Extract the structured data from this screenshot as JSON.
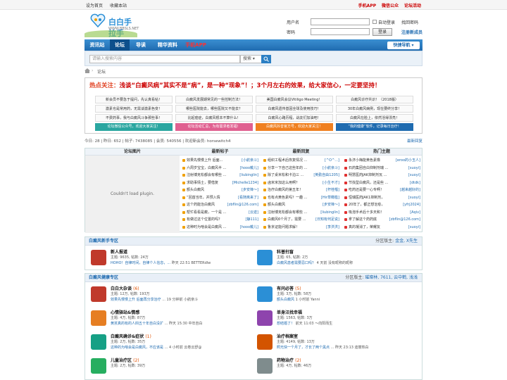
{
  "topbar": {
    "left": [
      "设为首页",
      "收藏本站"
    ],
    "right": [
      "手机APP",
      "微信公众",
      "论坛活动"
    ]
  },
  "logo": {
    "name": "白白手拉手",
    "url": "WWW.BBSLS.NET"
  },
  "login": {
    "username_label": "用户名",
    "password_label": "密码",
    "auto_login": "自动登录",
    "forgot": "找回密码",
    "login_button": "登录",
    "register": "注册新成员"
  },
  "nav": {
    "items": [
      "资讯站",
      "论坛",
      "导读",
      "精华资料",
      "手机APP"
    ],
    "quick": "快捷导航"
  },
  "search": {
    "placeholder": "请输入搜索内容",
    "select": "搜索",
    "button": "🔍"
  },
  "breadcrumb": {
    "home_icon": "home-icon",
    "current": "论坛"
  },
  "hot": {
    "lead": "热点关注：",
    "title": "浅谈“白癜风病”其实不是“病”，是一种“现象”！；3个月左右的效果，给大家信心，一定要坚持！",
    "cells": [
      [
        "新会员不要急于提问，先认真看帖！",
        "白癜风发展期常见的一些控制方法！",
        "美国白癜风会议Vitiligo Meeting！",
        "白癜风诊疗共识！（2018版）"
      ],
      [
        "激素也是常用药，无需谈激素色变！",
        "哪些医院能去，哪些医院又不能去？",
        "白癜风遗传基因全球及使用技巧！",
        "30年白癜风病例，现在要终分享！"
      ],
      [
        "不费药事，我与白癜风斗争那些事！",
        "比起癌症，白癜风根本不算什么！",
        "白癜风心路历程，战友们加油吧！",
        "白癜风在脸上，依然活得漂亮！"
      ],
      [
        "论坛微信公众号，欢迎大家关注！",
        "论坛活动汇总，为有需求者发福！",
        "白癜风抖音官方号，欢迎大家关注！",
        "“我的健康”软件，记录每日治疗！"
      ]
    ],
    "cell_colors": [
      "#2aa6a0",
      "#e06090",
      "#f08020",
      "#1f6bb0"
    ]
  },
  "stats": {
    "text": "今日: 28  |  昨日: 652  |  帖子: 7438085  |  会员: 540556  |  欢迎新会员: horsewitch4",
    "latest": "最新回复"
  },
  "panel": {
    "headers": [
      "论坛图片",
      "最新帖子",
      "最新回复",
      "热门主题"
    ],
    "plugin": "Couldn't load plugin.",
    "new_posts": [
      [
        "效果先慢慢上升 后面...",
        "[小航亲斗]"
      ],
      [
        "六周岁宝宝，白癜风半 ...",
        "[hooo戴儿]"
      ],
      [
        "注射博克松都会有哪些 ...",
        "[liubinglin]"
      ],
      [
        "求助事情士，要借复",
        "[Michelle1234]"
      ],
      [
        "额头白癜风",
        "[步安锋～]"
      ],
      [
        "“回首当年，并预入情",
        "[看随离来了]"
      ],
      [
        "这个药能治白癜风",
        "[zbflin@126.com]"
      ],
      [
        "帮忙看看是癜，一个是 ...",
        "[云迹]"
      ],
      [
        "有做过这个位置的吗？",
        "[静111]"
      ],
      [
        "这种时为啥会是白癜风 ...",
        "[hooo戴儿]"
      ]
    ],
    "new_replies": [
      [
        "组织工程术后恢复情况 ...",
        "[^O^...]"
      ],
      [
        "分享一下自己这些年的 ...",
        "[小航亲斗]"
      ],
      [
        "除了桌米松和卡泊三 ...",
        "[英勤自由1205]"
      ],
      [
        "卤米米加这么用啊？",
        "[小生不才]"
      ],
      [
        "治疗白癜风的第五年！",
        "[杆桂榴]"
      ],
      [
        "也有点黄色素吗？一趣 ...",
        "[Hir草橄槛]"
      ],
      [
        "额头白癜风",
        "[步安锋～]"
      ],
      [
        "注射博克松都会有哪些 ...",
        "[liubinglin]"
      ],
      [
        "白癜风6个月了，需要 ...",
        "[日知有何足说]"
      ],
      [
        "鲁京证能问题求解！",
        "[李洪洪]"
      ]
    ],
    "hot_topics": [
      [
        "永济小梅能黄色素橡",
        "[eroo的小玉人]"
      ],
      [
        "石药集团自白抑制剂瑞 ...",
        "[suoyi]"
      ],
      [
        "明慧医药JAK抑制剂瓦 ...",
        "[suoyi]"
      ],
      [
        "节找型白癜风，还是些 ...",
        "[dtdk]"
      ],
      [
        "吃药还是要一心专啊！",
        "[越来越好的]"
      ],
      [
        "恒瑞医药JAK1抑制剂，",
        "[suoyi]"
      ],
      [
        "20年了，都正想治愈，",
        "[yfrj2024]"
      ],
      [
        "吸泡手术后十多天和！",
        "[Aqiv]"
      ],
      [
        "拿了解这个药药底",
        "[zbflin@126.com]"
      ],
      [
        "真的凝消了，荣耀友",
        "[suoyi]"
      ]
    ]
  },
  "newbie": {
    "title": "白癜风新手专区",
    "moderators_label": "分区版主:",
    "moderators": "金金, X先生",
    "forums": [
      {
        "name": "新人报道",
        "meta": "主题: 9635, 帖数: 24万",
        "last": "HOHO！自律时间，自律个人信息，...",
        "time": "昨天 22:51 BETTERdlw"
      },
      {
        "name": "科普扫盲",
        "meta": "主题: 65, 帖数: 2万",
        "last": "白癜风患者需要忌口吗？",
        "time": "4 天前 没有昵称的昵称"
      }
    ]
  },
  "care": {
    "title": "白癜风健康专区",
    "moderators_label": "分区版主:",
    "moderators": "璀璨林, 7611, 云中鹤, 浅浅",
    "forums": [
      {
        "name": "白白大杂谈",
        "count": "(6)",
        "meta": "主题: 12万, 帖数: 193万",
        "last": "效果先慢慢上升 后面再分享治疗",
        "time": "... 19 分钟前 小航亲斗"
      },
      {
        "name": "有问必答",
        "count": "(5)",
        "meta": "主题: 3万, 帖数: 58万",
        "last": "额头白癜风",
        "time": "1 小时前 Yanni"
      },
      {
        "name": "心情驿站&情感",
        "count": "",
        "meta": "主题: 4万, 帖数: 87万",
        "last": "黄芪真的有的人四五十年自白没扩",
        "time": "... 昨天 15:30 中年自白"
      },
      {
        "name": "单身汪找幸福",
        "count": "",
        "meta": "主题: 1563, 帖数: 3万",
        "last": "想结婚了！",
        "time": "前天 11:03 ～向阳而生"
      },
      {
        "name": "白癜风确诊&症状",
        "count": "(1)",
        "meta": "主题: 2万, 帖数: 35万",
        "last": "这种的为啥会是白癜风，不应该是",
        "time": "... 4 小时前 云卷云舒@"
      },
      {
        "name": "治疗档案室",
        "count": "",
        "meta": "主题: 4149, 帖数: 13万",
        "last": "照光快一个月了，才长了两个黑点",
        "time": "... 昨天 23:13 迪丽热白"
      },
      {
        "name": "儿童治疗区",
        "count": "(2)",
        "meta": "主题: 2万, 帖数: 39万",
        "last": "",
        "time": ""
      },
      {
        "name": "药物治疗",
        "count": "(2)",
        "meta": "主题: 4万, 帖数: 46万",
        "last": "",
        "time": ""
      }
    ]
  }
}
